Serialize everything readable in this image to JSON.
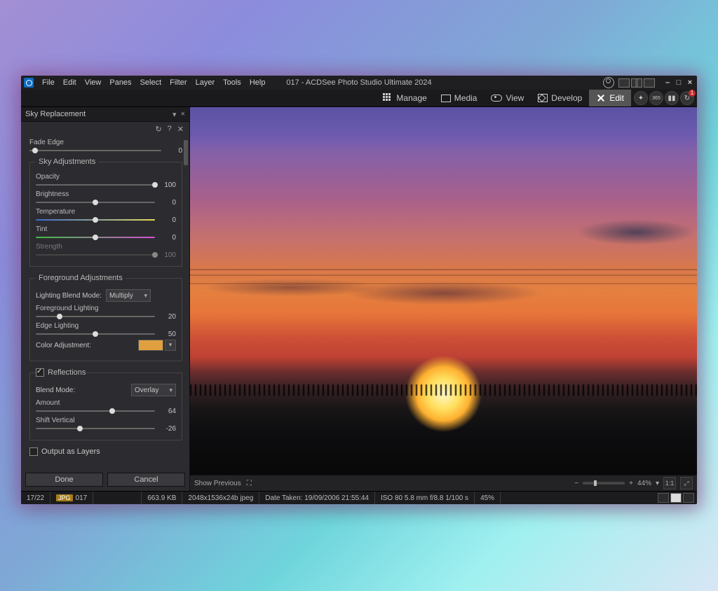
{
  "appTitle": "017 - ACDSee Photo Studio Ultimate 2024",
  "menu": [
    "File",
    "Edit",
    "View",
    "Panes",
    "Select",
    "Filter",
    "Layer",
    "Tools",
    "Help"
  ],
  "modes": {
    "manage": "Manage",
    "media": "Media",
    "view": "View",
    "develop": "Develop",
    "edit": "Edit",
    "badge365": "365",
    "notifyCount": "1"
  },
  "panel": {
    "title": "Sky Replacement",
    "fadeEdge": {
      "label": "Fade Edge",
      "value": "0",
      "knob": 4
    },
    "skyAdj": {
      "legend": "Sky Adjustments",
      "opacity": {
        "label": "Opacity",
        "value": "100",
        "knob": 100
      },
      "brightness": {
        "label": "Brightness",
        "value": "0",
        "knob": 50
      },
      "temperature": {
        "label": "Temperature",
        "value": "0",
        "knob": 50
      },
      "tint": {
        "label": "Tint",
        "value": "0",
        "knob": 50
      },
      "strength": {
        "label": "Strength",
        "value": "100",
        "knob": 100
      }
    },
    "fgAdj": {
      "legend": "Foreground Adjustments",
      "blendLabel": "Lighting Blend Mode:",
      "blendValue": "Multiply",
      "fgLight": {
        "label": "Foreground Lighting",
        "value": "20",
        "knob": 20
      },
      "edgeLight": {
        "label": "Edge Lighting",
        "value": "50",
        "knob": 50
      },
      "colorAdjLabel": "Color Adjustment:",
      "swatch": "#e0a040"
    },
    "refl": {
      "legend": "Reflections",
      "blendLabel": "Blend Mode:",
      "blendValue": "Overlay",
      "amount": {
        "label": "Amount",
        "value": "64",
        "knob": 64
      },
      "shift": {
        "label": "Shift Vertical",
        "value": "-26",
        "knob": 37
      }
    },
    "outputLayers": "Output as Layers",
    "done": "Done",
    "cancel": "Cancel"
  },
  "viewer": {
    "showPrev": "Show Previous",
    "zoom": "44%",
    "oneToOne": "1:1"
  },
  "status": {
    "index": "17/22",
    "fmt": "JPG",
    "name": "017",
    "size": "663.9 KB",
    "dims": "2048x1536x24b jpeg",
    "date": "Date Taken: 19/09/2006 21:55:44",
    "exif": "ISO 80   5.8 mm   f/8.8   1/100 s",
    "extra": "45%"
  }
}
